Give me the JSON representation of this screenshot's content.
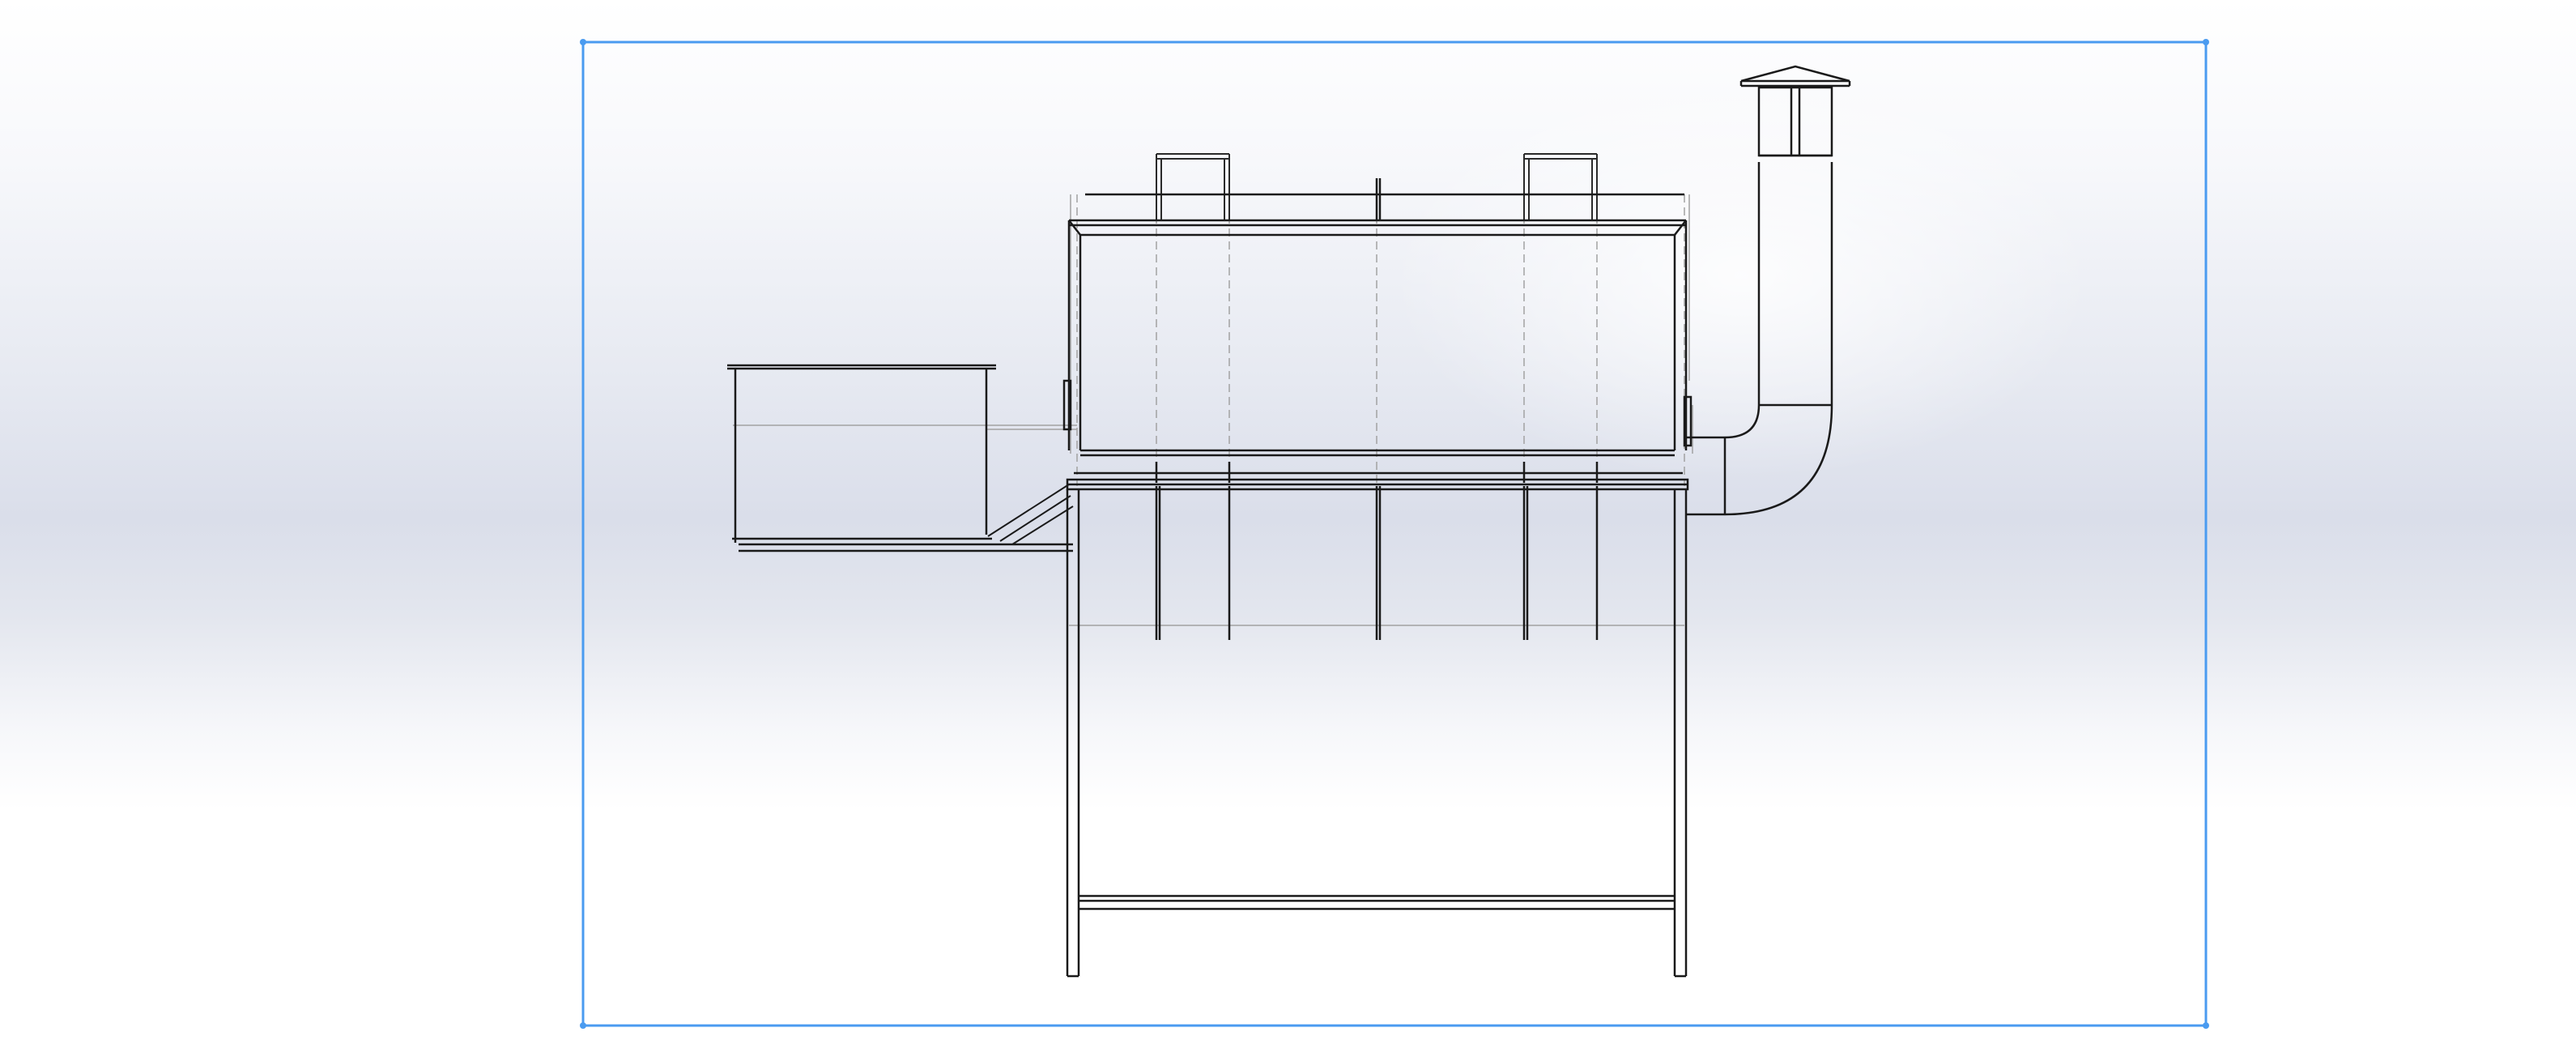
{
  "viewport": {
    "background_top": "#ffffff",
    "background_band": "#dadeea",
    "selection_color": "#4a9bf0",
    "line_color": "#1a1a1a",
    "hidden_line_color": "#9a9a9a"
  },
  "model": {
    "components": [
      "hopper",
      "hopper-support-brace",
      "drum-housing",
      "housing-lid",
      "lid-handle-left",
      "lid-handle-right",
      "agitator-shafts",
      "exhaust-elbow",
      "exhaust-chimney",
      "chimney-cap",
      "frame-table",
      "frame-legs",
      "frame-lower-rail"
    ]
  }
}
